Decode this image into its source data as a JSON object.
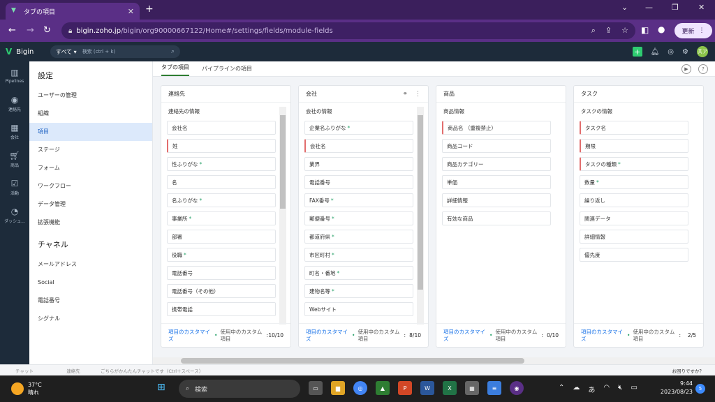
{
  "browser": {
    "tab_title": "タブの項目",
    "tab_close": "✕",
    "new_tab": "+",
    "url_host": "bigin.zoho.jp",
    "url_path": "/bigin/org90000667122/Home#/settings/fields/module-fields",
    "update_label": "更新"
  },
  "app": {
    "name": "Bigin",
    "search_scope": "すべて",
    "search_placeholder": "検索 (ctrl + k)",
    "avatar_text": "共ア"
  },
  "rail": [
    {
      "label": "Pipelines",
      "icon": "pipelines-icon"
    },
    {
      "label": "連絡先",
      "icon": "contacts-icon"
    },
    {
      "label": "会社",
      "icon": "company-icon"
    },
    {
      "label": "商品",
      "icon": "products-icon"
    },
    {
      "label": "活動",
      "icon": "activities-icon"
    },
    {
      "label": "ダッシュ...",
      "icon": "dashboard-icon"
    }
  ],
  "sidebar": {
    "title": "設定",
    "items": [
      "ユーザーの管理",
      "組織",
      "項目",
      "ステージ",
      "フォーム",
      "ワークフロー",
      "データ管理",
      "拡張機能"
    ],
    "channels_title": "チャネル",
    "channels": [
      "メールアドレス",
      "Social",
      "電話番号",
      "シグナル"
    ]
  },
  "tabs": [
    "タブの項目",
    "パイプラインの項目"
  ],
  "cards": [
    {
      "title": "連絡先",
      "section": "連絡先の情報",
      "fields": [
        {
          "label": "会社名",
          "req": false,
          "ast": ""
        },
        {
          "label": "姓",
          "req": true,
          "ast": ""
        },
        {
          "label": "性ふりがな",
          "req": false,
          "ast": "*"
        },
        {
          "label": "名",
          "req": false,
          "ast": ""
        },
        {
          "label": "名ふりがな",
          "req": false,
          "ast": "*"
        },
        {
          "label": "事業所",
          "req": false,
          "ast": "*"
        },
        {
          "label": "部署",
          "req": false,
          "ast": ""
        },
        {
          "label": "役職",
          "req": false,
          "ast": "*"
        },
        {
          "label": "電話番号",
          "req": false,
          "ast": ""
        },
        {
          "label": "電話番号（その他）",
          "req": false,
          "ast": ""
        },
        {
          "label": "携帯電話",
          "req": false,
          "ast": ""
        }
      ],
      "customize": "項目のカスタマイズ",
      "usage_label": "使用中のカスタム項目",
      "count": "10/10"
    },
    {
      "title": "会社",
      "section": "会社の情報",
      "fields": [
        {
          "label": "企業名ふりがな",
          "req": false,
          "ast": "*"
        },
        {
          "label": "会社名",
          "req": true,
          "ast": ""
        },
        {
          "label": "業界",
          "req": false,
          "ast": ""
        },
        {
          "label": "電話番号",
          "req": false,
          "ast": ""
        },
        {
          "label": "FAX番号",
          "req": false,
          "ast": "*"
        },
        {
          "label": "郵便番号",
          "req": false,
          "ast": "*"
        },
        {
          "label": "都道府県",
          "req": false,
          "ast": "*"
        },
        {
          "label": "市区町村",
          "req": false,
          "ast": "*"
        },
        {
          "label": "町名・番地",
          "req": false,
          "ast": "*"
        },
        {
          "label": "建物名等",
          "req": false,
          "ast": "*"
        },
        {
          "label": "Webサイト",
          "req": false,
          "ast": ""
        }
      ],
      "customize": "項目のカスタマイズ",
      "usage_label": "使用中のカスタム項目",
      "count": "8/10"
    },
    {
      "title": "商品",
      "section": "商品情報",
      "fields": [
        {
          "label": "商品名 （重複禁止）",
          "req": true,
          "ast": ""
        },
        {
          "label": "商品コード",
          "req": false,
          "ast": ""
        },
        {
          "label": "商品カテゴリー",
          "req": false,
          "ast": ""
        },
        {
          "label": "単価",
          "req": false,
          "ast": ""
        },
        {
          "label": "詳細情報",
          "req": false,
          "ast": ""
        },
        {
          "label": "有効な商品",
          "req": false,
          "ast": ""
        }
      ],
      "customize": "項目のカスタマイズ",
      "usage_label": "使用中のカスタム項目",
      "count": "0/10"
    },
    {
      "title": "タスク",
      "section": "タスクの情報",
      "fields": [
        {
          "label": "タスク名",
          "req": true,
          "ast": ""
        },
        {
          "label": "期限",
          "req": true,
          "ast": ""
        },
        {
          "label": "タスクの種類",
          "req": true,
          "ast": "*"
        },
        {
          "label": "数量",
          "req": false,
          "ast": "*"
        },
        {
          "label": "繰り返し",
          "req": false,
          "ast": ""
        },
        {
          "label": "関連データ",
          "req": false,
          "ast": ""
        },
        {
          "label": "詳細情報",
          "req": false,
          "ast": ""
        },
        {
          "label": "優先度",
          "req": false,
          "ast": ""
        }
      ],
      "customize": "項目のカスタマイズ",
      "usage_label": "使用中のカスタム項目",
      "count": "2/5"
    }
  ],
  "chatbar": {
    "chat": "チャット",
    "contacts": "連絡先",
    "placeholder": "ごちらがかんたんチャットです（Ctrl＋スペース）",
    "help": "お困りですか？"
  },
  "taskbar": {
    "temp": "37°C",
    "weather": "晴れ",
    "search": "検索",
    "time": "9:44",
    "date": "2023/08/23",
    "ime": "あ",
    "notifications": "5"
  },
  "colors": {
    "chrome": "#5a2f86",
    "app_header": "#1d2b3a",
    "accent": "#2ecc71",
    "active_item": "#dce9fb",
    "required_marker": "#e26d6d"
  }
}
